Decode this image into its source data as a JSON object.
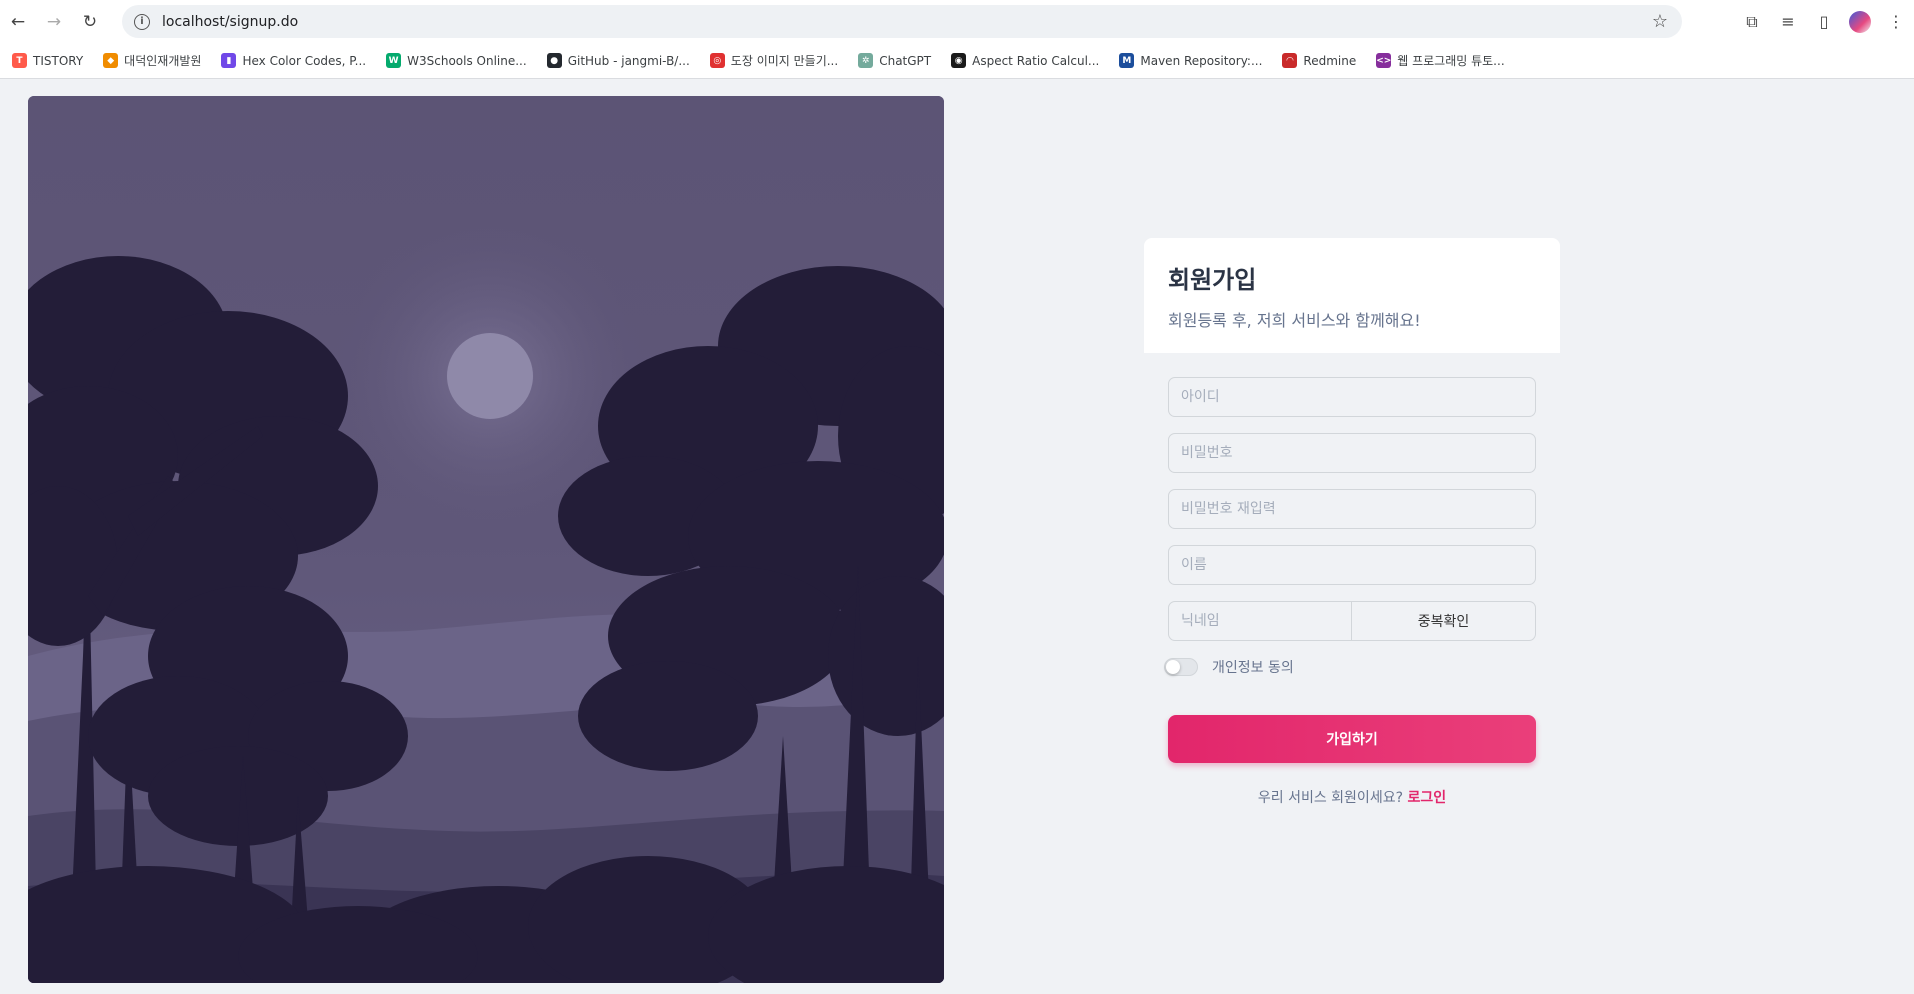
{
  "browser": {
    "url": "localhost/signup.do",
    "bookmarks": [
      {
        "label": "TISTORY",
        "color": "#ff5a4a",
        "icon": "T"
      },
      {
        "label": "대덕인재개발원",
        "color": "#f08c00",
        "icon": "◆"
      },
      {
        "label": "Hex Color Codes, P...",
        "color": "#7048e8",
        "icon": "▮"
      },
      {
        "label": "W3Schools Online...",
        "color": "#04aa6d",
        "icon": "W"
      },
      {
        "label": "GitHub - jangmi-B/...",
        "color": "#24292f",
        "icon": "●"
      },
      {
        "label": "도장 이미지 만들기...",
        "color": "#e03131",
        "icon": "◎"
      },
      {
        "label": "ChatGPT",
        "color": "#74aa9c",
        "icon": "✲"
      },
      {
        "label": "Aspect Ratio Calcul...",
        "color": "#1a1a1a",
        "icon": "◉"
      },
      {
        "label": "Maven Repository:...",
        "color": "#1c4e9c",
        "icon": "M"
      },
      {
        "label": "Redmine",
        "color": "#c92a2a",
        "icon": "◠"
      },
      {
        "label": "웹 프로그래밍 튜토...",
        "color": "#862e9c",
        "icon": "<>"
      }
    ]
  },
  "signup": {
    "title": "회원가입",
    "subtitle": "회원등록 후, 저희 서비스와 함께해요!",
    "fields": {
      "id_placeholder": "아이디",
      "password_placeholder": "비밀번호",
      "password_confirm_placeholder": "비밀번호 재입력",
      "name_placeholder": "이름",
      "nickname_placeholder": "닉네임"
    },
    "duplicate_check_label": "중복확인",
    "privacy_label": "개인정보 동의",
    "privacy_checked": false,
    "submit_label": "가입하기",
    "footer_text": "우리 서비스 회원이세요?",
    "login_link": "로그인"
  },
  "colors": {
    "accent": "#e2266b",
    "background": "#f0f2f5",
    "night_sky": "#5d5478",
    "tree": "#231d38"
  }
}
